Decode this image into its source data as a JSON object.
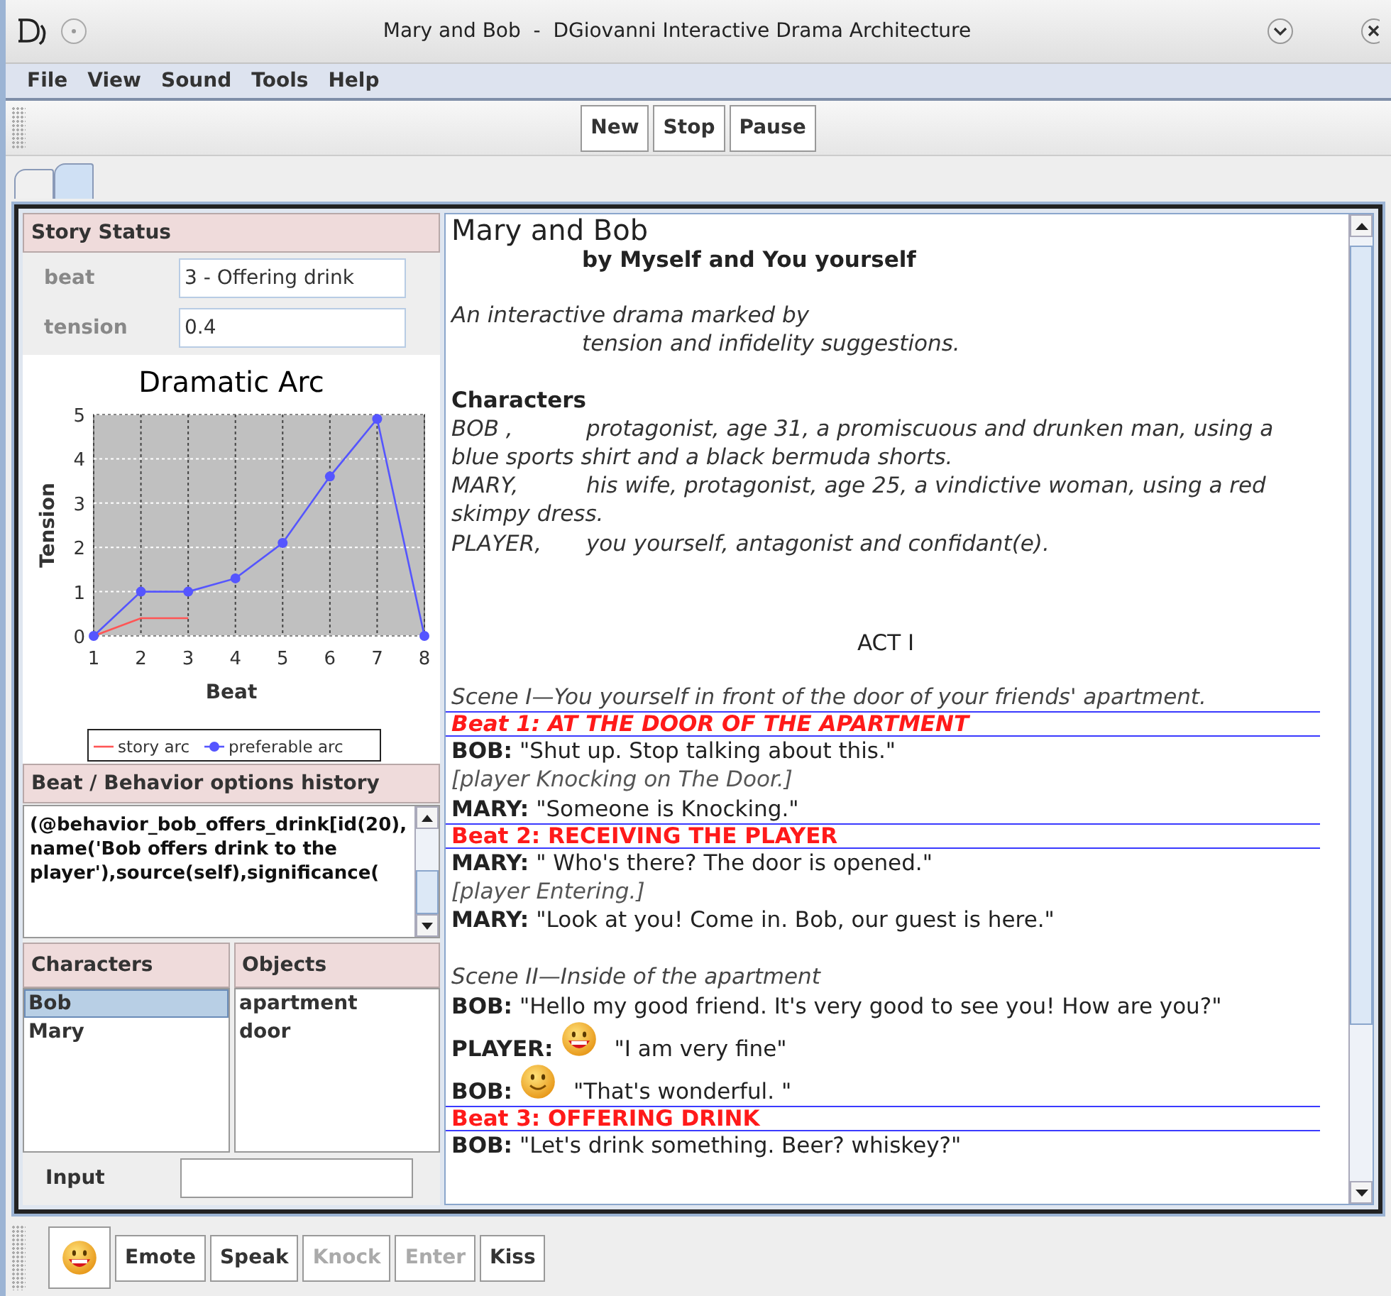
{
  "window": {
    "title": "Mary and Bob  -  DGiovanni Interactive Drama Architecture"
  },
  "menu": [
    "File",
    "View",
    "Sound",
    "Tools",
    "Help"
  ],
  "toolbar": [
    {
      "label": "New",
      "disabled": false
    },
    {
      "label": "Stop",
      "disabled": false
    },
    {
      "label": "Pause",
      "disabled": false
    }
  ],
  "tabs": [
    {
      "selected": false
    },
    {
      "selected": true
    }
  ],
  "story_status": {
    "header": "Story Status",
    "fields": [
      {
        "label": "beat",
        "value": "3 - Offering drink"
      },
      {
        "label": "tension",
        "value": "0.4"
      }
    ],
    "chart_data": {
      "type": "line",
      "title": "Dramatic Arc",
      "xlabel": "Beat",
      "ylabel": "Tension",
      "x": [
        1,
        2,
        3,
        4,
        5,
        6,
        7,
        8
      ],
      "series": [
        {
          "name": "story arc",
          "color": "#ff5555",
          "values": [
            0,
            0.4,
            0.4,
            null,
            null,
            null,
            null,
            null
          ]
        },
        {
          "name": "preferable arc",
          "color": "#5555ff",
          "values": [
            0,
            1,
            1,
            1.3,
            2.1,
            3.6,
            4.9,
            0
          ],
          "marker": "circle"
        }
      ],
      "xlim": [
        1,
        8
      ],
      "ylim": [
        0,
        5
      ],
      "xticks": [
        1,
        2,
        3,
        4,
        5,
        6,
        7,
        8
      ],
      "yticks": [
        0,
        1,
        2,
        3,
        4,
        5
      ],
      "grid": true,
      "legend": true
    }
  },
  "history": {
    "header": "Beat / Behavior options history",
    "text": "(@behavior_bob_offers_drink[id(20),name('Bob offers drink to the player'),source(self),significance("
  },
  "characters": {
    "header": "Characters",
    "items": [
      {
        "label": "Bob",
        "selected": true
      },
      {
        "label": "Mary",
        "selected": false
      }
    ]
  },
  "objects": {
    "header": "Objects",
    "items": [
      {
        "label": "apartment",
        "selected": false
      },
      {
        "label": "door",
        "selected": false
      }
    ]
  },
  "input": {
    "label": "Input"
  },
  "script": [
    {
      "kind": "title",
      "text": "Mary and Bob"
    },
    {
      "kind": "byline",
      "text": "by Myself and You yourself"
    },
    {
      "kind": "intro",
      "text": "An interactive drama marked by",
      "indented": false
    },
    {
      "kind": "intro",
      "text": "tension and infidelity suggestions.",
      "indented": true
    },
    {
      "kind": "heading",
      "text": "Characters"
    },
    {
      "kind": "character",
      "name": "BOB ,",
      "text": "protagonist, age 31, a promiscuous and drunken man, using a blue sports shirt and a black bermuda shorts."
    },
    {
      "kind": "character",
      "name": "MARY,",
      "text": "his wife, protagonist, age 25, a vindictive woman, using a red skimpy dress."
    },
    {
      "kind": "character",
      "name": "PLAYER,",
      "text": "you yourself, antagonist and confidant(e)."
    },
    {
      "kind": "act",
      "text": "ACT I"
    },
    {
      "kind": "scene",
      "text": "Scene I—You yourself in front of the door of your friends' apartment."
    },
    {
      "kind": "beat",
      "text": "Beat 1: AT THE DOOR OF THE APARTMENT",
      "italic": true
    },
    {
      "kind": "dialogue",
      "speaker": "BOB:",
      "text": "\"Shut up. Stop talking about this.\""
    },
    {
      "kind": "action",
      "text": "[player Knocking on The Door.]"
    },
    {
      "kind": "dialogue",
      "speaker": "MARY:",
      "text": "\"Someone is Knocking.\""
    },
    {
      "kind": "beat",
      "text": "Beat 2: RECEIVING THE PLAYER",
      "italic": false
    },
    {
      "kind": "dialogue",
      "speaker": "MARY:",
      "text": "\" Who's there? The door is opened.\""
    },
    {
      "kind": "action",
      "text": "[player Entering.]"
    },
    {
      "kind": "dialogue",
      "speaker": "MARY:",
      "text": "\"Look at you! Come in. Bob, our guest is here.\""
    },
    {
      "kind": "scene",
      "text": "Scene II—Inside of the apartment"
    },
    {
      "kind": "dialogue",
      "speaker": "BOB:",
      "text": "\"Hello my good friend. It's very good to see you! How are you?\""
    },
    {
      "kind": "dialogue",
      "speaker": "PLAYER:",
      "text": "\"I am very fine\"",
      "emote": {
        "kind": "grin"
      }
    },
    {
      "kind": "dialogue",
      "speaker": "BOB:",
      "text": "\"That's wonderful. \"",
      "emote": {
        "kind": "smile"
      }
    },
    {
      "kind": "beat",
      "text": "Beat 3: OFFERING DRINK",
      "italic": false
    },
    {
      "kind": "dialogue",
      "speaker": "BOB:",
      "text": "\"Let's drink something. Beer? whiskey?\""
    }
  ],
  "actions": [
    {
      "label": "Emote",
      "disabled": false
    },
    {
      "label": "Speak",
      "disabled": false
    },
    {
      "label": "Knock",
      "disabled": true
    },
    {
      "label": "Enter",
      "disabled": true
    },
    {
      "label": "Kiss",
      "disabled": false
    }
  ]
}
